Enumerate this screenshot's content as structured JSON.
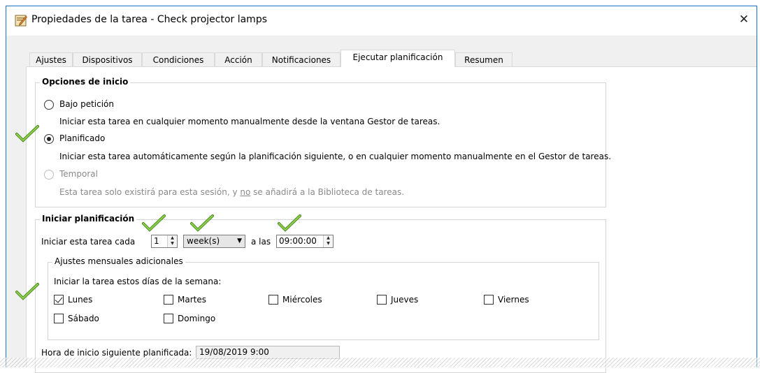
{
  "window": {
    "title": "Propiedades de la tarea - Check projector lamps",
    "close_glyph": "✕"
  },
  "tabs": [
    {
      "label": "Ajustes"
    },
    {
      "label": "Dispositivos"
    },
    {
      "label": "Condiciones"
    },
    {
      "label": "Acción"
    },
    {
      "label": "Notificaciones"
    },
    {
      "label": "Ejecutar planificación",
      "active": true
    },
    {
      "label": "Resumen"
    }
  ],
  "start_options": {
    "legend": "Opciones de inicio",
    "on_demand": {
      "label": "Bajo petición",
      "desc": "Iniciar esta tarea en cualquier momento manualmente desde la ventana Gestor de tareas.",
      "checked": false
    },
    "scheduled": {
      "label": "Planificado",
      "desc": "Iniciar esta tarea automáticamente según la planificación siguiente, o en cualquier momento manualmente en el Gestor de tareas.",
      "checked": true
    },
    "temporal": {
      "label": "Temporal",
      "desc_before": "Esta tarea solo existirá para esta sesión, y ",
      "desc_underline": "no",
      "desc_after": " se añadirá a la Biblioteca de tareas.",
      "disabled": true
    }
  },
  "schedule": {
    "legend": "Iniciar planificación",
    "every_label": "Iniciar esta tarea cada",
    "interval_value": "1",
    "unit_value": "week(s)",
    "at_label": "a las",
    "time_value": "09:00:00",
    "monthly_legend": "Ajustes mensuales adicionales",
    "days_label": "Iniciar la tarea estos días de la semana:",
    "days": [
      {
        "label": "Lunes",
        "checked": true
      },
      {
        "label": "Martes",
        "checked": false
      },
      {
        "label": "Miércoles",
        "checked": false
      },
      {
        "label": "Jueves",
        "checked": false
      },
      {
        "label": "Viernes",
        "checked": false
      },
      {
        "label": "Sábado",
        "checked": false
      },
      {
        "label": "Domingo",
        "checked": false
      }
    ],
    "next_run_label": "Hora de inicio siguiente planificada:",
    "next_run_value": "19/08/2019 9:00"
  },
  "colors": {
    "window_border": "#1a73c9",
    "annotation_check": "#7ac143",
    "annotation_check_dark": "#4a8a1c"
  },
  "icons": [
    "task-properties-icon",
    "close-icon",
    "spin-up-icon",
    "spin-down-icon",
    "dropdown-arrow-icon",
    "annotation-check-icon"
  ]
}
